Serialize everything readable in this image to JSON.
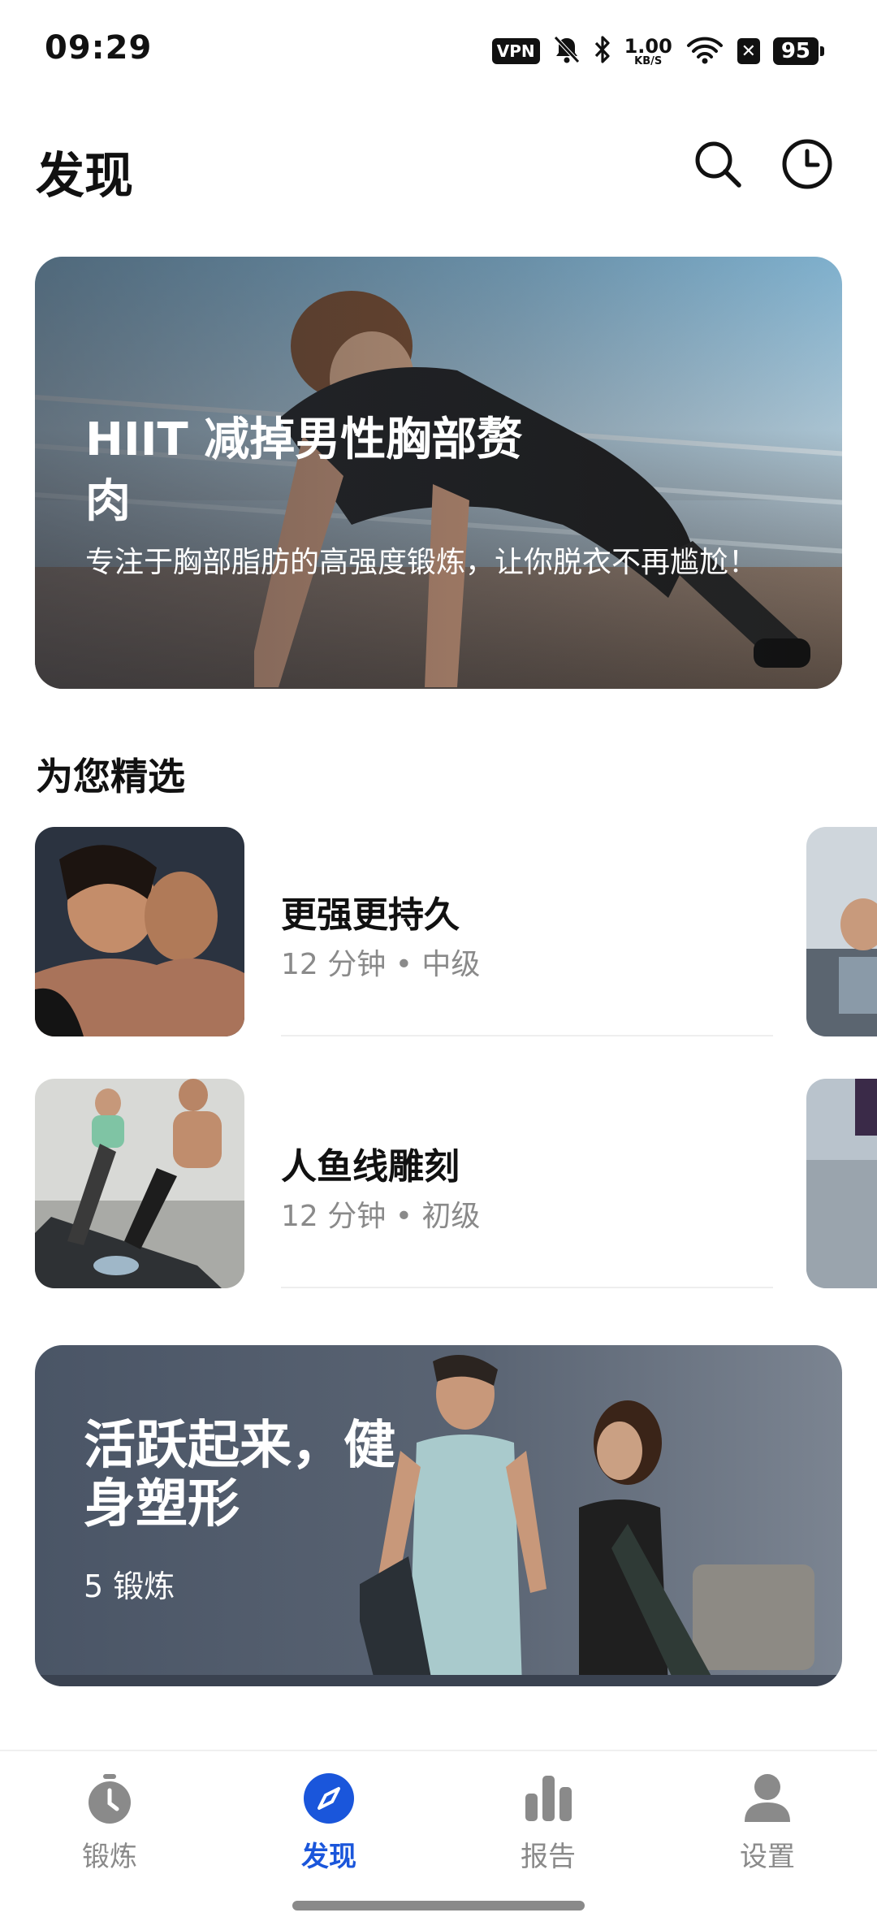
{
  "status_bar": {
    "time": "09:29",
    "vpn": "VPN",
    "net_speed_value": "1.00",
    "net_speed_unit": "KB/S",
    "battery": "95",
    "icons": [
      "vpn-icon",
      "mute-icon",
      "bluetooth-icon",
      "network-speed",
      "wifi-icon",
      "x-icon",
      "battery-icon"
    ]
  },
  "header": {
    "title": "发现",
    "icons": [
      "search-icon",
      "history-clock-icon"
    ]
  },
  "hero": {
    "title": "HIIT 减掉男性胸部赘肉",
    "subtitle": "专注于胸部脂肪的高强度锻炼，让你脱衣不再尴尬！"
  },
  "section": {
    "title": "为您精选",
    "items": [
      {
        "title": "更强更持久",
        "meta": "12 分钟 • 中级"
      },
      {
        "title": "人鱼线雕刻",
        "meta": "12 分钟 • 初级"
      }
    ]
  },
  "promo": {
    "title": "活跃起来，健身塑形",
    "count": "5 锻炼"
  },
  "bottom_nav": {
    "items": [
      {
        "label": "锻炼",
        "icon": "stopwatch-icon",
        "active": false
      },
      {
        "label": "发现",
        "icon": "compass-icon",
        "active": true
      },
      {
        "label": "报告",
        "icon": "bar-chart-icon",
        "active": false
      },
      {
        "label": "设置",
        "icon": "person-icon",
        "active": false
      }
    ]
  },
  "colors": {
    "accent": "#1a56db",
    "text": "#111111",
    "muted": "#8a8a8a"
  }
}
